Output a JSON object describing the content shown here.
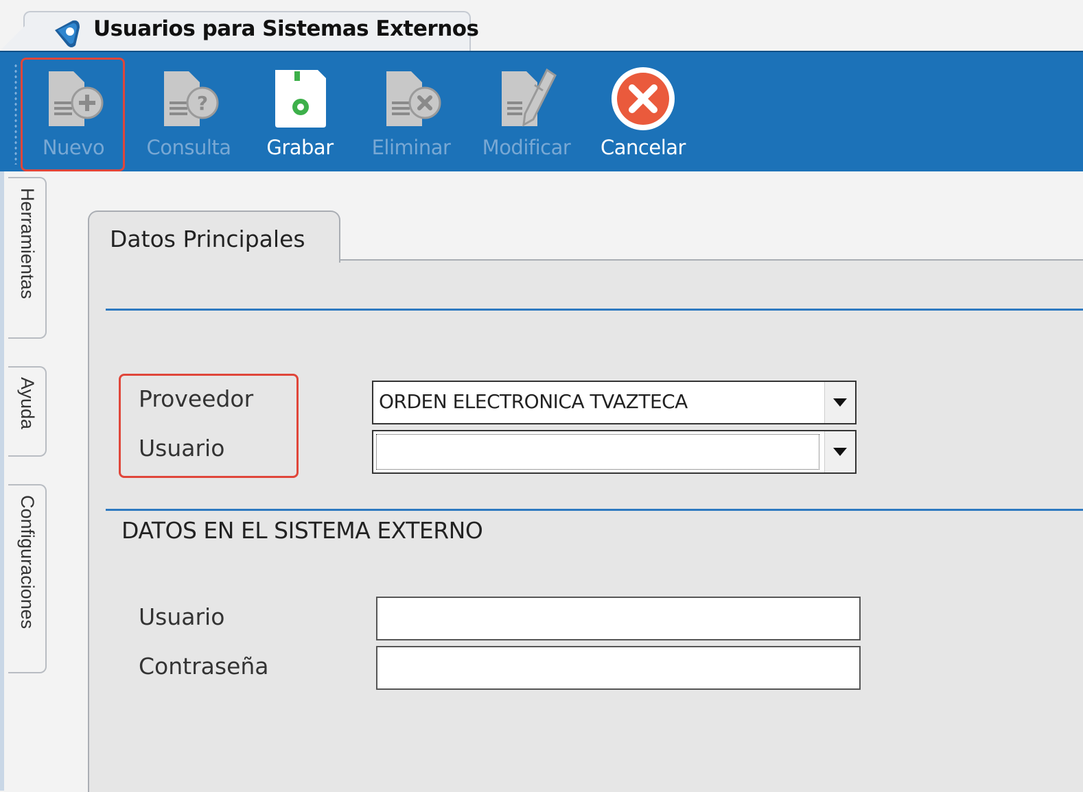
{
  "window": {
    "title": "Usuarios para Sistemas Externos"
  },
  "toolbar": {
    "nuevo": "Nuevo",
    "consulta": "Consulta",
    "grabar": "Grabar",
    "eliminar": "Eliminar",
    "modificar": "Modificar",
    "cancelar": "Cancelar"
  },
  "side_tabs": {
    "herramientas": "Herramientas",
    "ayuda": "Ayuda",
    "configuraciones": "Configuraciones"
  },
  "form": {
    "tab_label": "Datos Principales",
    "proveedor_label": "Proveedor",
    "proveedor_value": "ORDEN ELECTRONICA TVAZTECA",
    "usuario_label": "Usuario",
    "usuario_value": "",
    "section_title": "DATOS EN EL SISTEMA EXTERNO",
    "ext_usuario_label": "Usuario",
    "ext_usuario_value": "",
    "ext_password_label": "Contraseña",
    "ext_password_value": ""
  },
  "colors": {
    "toolbar_bg": "#1c72b8",
    "highlight": "#e0463a",
    "rule": "#2d79c0"
  }
}
